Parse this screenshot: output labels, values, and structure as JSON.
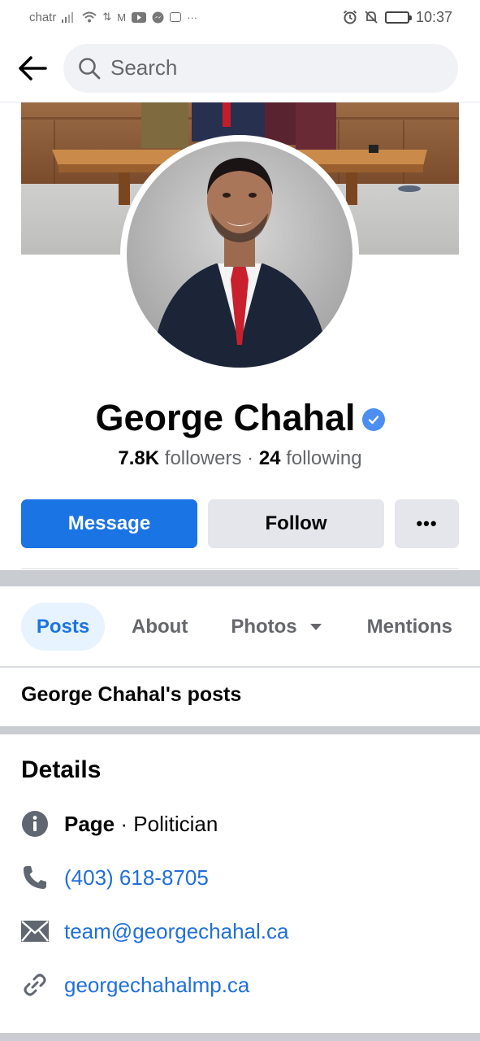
{
  "status_bar": {
    "carrier": "chatr",
    "time": "10:37"
  },
  "search": {
    "placeholder": "Search"
  },
  "profile": {
    "name": "George Chahal",
    "followers_count": "7.8K",
    "followers_label": "followers",
    "separator": "·",
    "following_count": "24",
    "following_label": "following"
  },
  "actions": {
    "message_label": "Message",
    "follow_label": "Follow",
    "more_label": "•••"
  },
  "tabs": {
    "posts": "Posts",
    "about": "About",
    "photos": "Photos",
    "mentions": "Mentions"
  },
  "posts_section": {
    "heading": "George Chahal's posts"
  },
  "details": {
    "title": "Details",
    "page_label": "Page",
    "page_separator": " · ",
    "category": "Politician",
    "phone": "(403) 618-8705",
    "email": "team@georgechahal.ca",
    "website": "georgechahalmp.ca"
  },
  "colors": {
    "accent": "#1b74e4",
    "link": "#216fdb",
    "verified": "#4a8ff1",
    "tab_active_bg": "#e7f3ff"
  }
}
